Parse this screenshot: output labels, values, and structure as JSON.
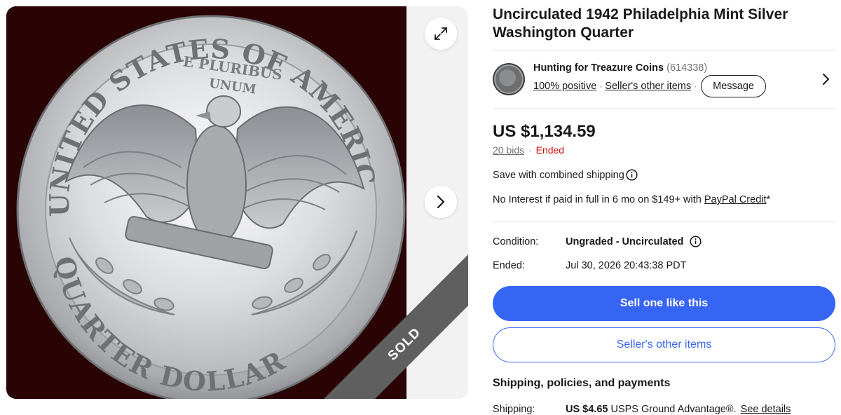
{
  "listing": {
    "title": "Uncirculated 1942 Philadelphia Mint Silver Washington Quarter",
    "photo_alt": "Reverse of 1942 Washington quarter showing eagle",
    "sold_label": "SOLD"
  },
  "coin_text": {
    "rim_top": "UNITED STATES OF AMERICA",
    "rim_bottom": "QUARTER DOLLAR",
    "motto_1": "E PLURIBUS",
    "motto_2": "UNUM"
  },
  "gallery": {
    "expand_icon": "expand-icon",
    "next_icon": "chevron-right-icon"
  },
  "seller": {
    "name": "Hunting for Treazure Coins",
    "feedback_count": "(614338)",
    "positive": "100% positive",
    "sep": "·",
    "other_items": "Seller's other items",
    "message_label": "Message"
  },
  "pricing": {
    "price": "US $1,134.59",
    "bids": "20 bids",
    "bids_sep": "·",
    "status": "Ended",
    "save_shipping": "Save with combined shipping",
    "credit_prefix": "No Interest if paid in full in 6 mo on $149+ with ",
    "credit_link": "PayPal Credit",
    "credit_suffix": "*"
  },
  "details": {
    "condition_label": "Condition:",
    "condition_value": "Ungraded - Uncirculated",
    "ended_label": "Ended:",
    "ended_value": "Jul 30, 2026 20:43:38 PDT"
  },
  "actions": {
    "sell_one": "Sell one like this",
    "sellers_other_items": "Seller's other items"
  },
  "shipping": {
    "heading": "Shipping, policies, and payments",
    "label": "Shipping:",
    "cost": "US $4.65",
    "method": "USPS Ground Advantage®.",
    "details_link": "See details"
  },
  "colors": {
    "primary_blue": "#3665f3",
    "ended_red": "#d50b0b",
    "photo_bg": "#2a0404",
    "sold_ribbon": "#5f5f5f"
  }
}
